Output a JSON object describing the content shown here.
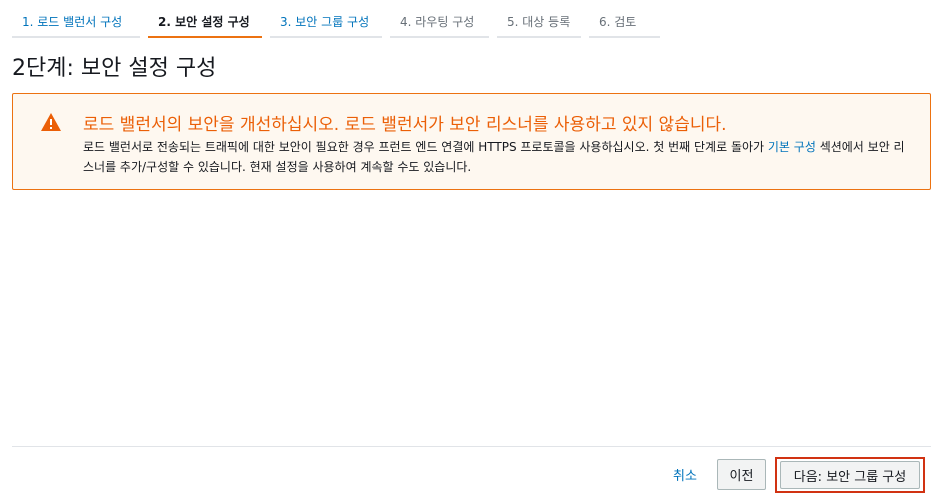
{
  "steps": [
    {
      "label": "1. 로드 밸런서 구성"
    },
    {
      "label": "2. 보안 설정 구성"
    },
    {
      "label": "3. 보안 그룹 구성"
    },
    {
      "label": "4. 라우팅 구성"
    },
    {
      "label": "5. 대상 등록"
    },
    {
      "label": "6. 검토"
    }
  ],
  "page_title": "2단계: 보안 설정 구성",
  "alert": {
    "icon": "warning-icon",
    "title": "로드 밸런서의 보안을 개선하십시오. 로드 밸런서가 보안 리스너를 사용하고 있지 않습니다.",
    "body_1": "로드 밸런서로 전송되는 트래픽에 대한 보안이 필요한 경우 프런트 엔드 연결에 HTTPS 프로토콜을 사용하십시오. 첫 번째 단계로 돌아가 ",
    "body_link": "기본 구성",
    "body_2": " 섹션에서 보안 리스너를 추가/구성할 수 있습니다. 현재 설정을 사용하여 계속할 수도 있습니다."
  },
  "footer": {
    "cancel": "취소",
    "previous": "이전",
    "next": "다음: 보안 그룹 구성"
  },
  "colors": {
    "link": "#0073bb",
    "warning": "#ec7211",
    "highlight": "#d13212"
  }
}
